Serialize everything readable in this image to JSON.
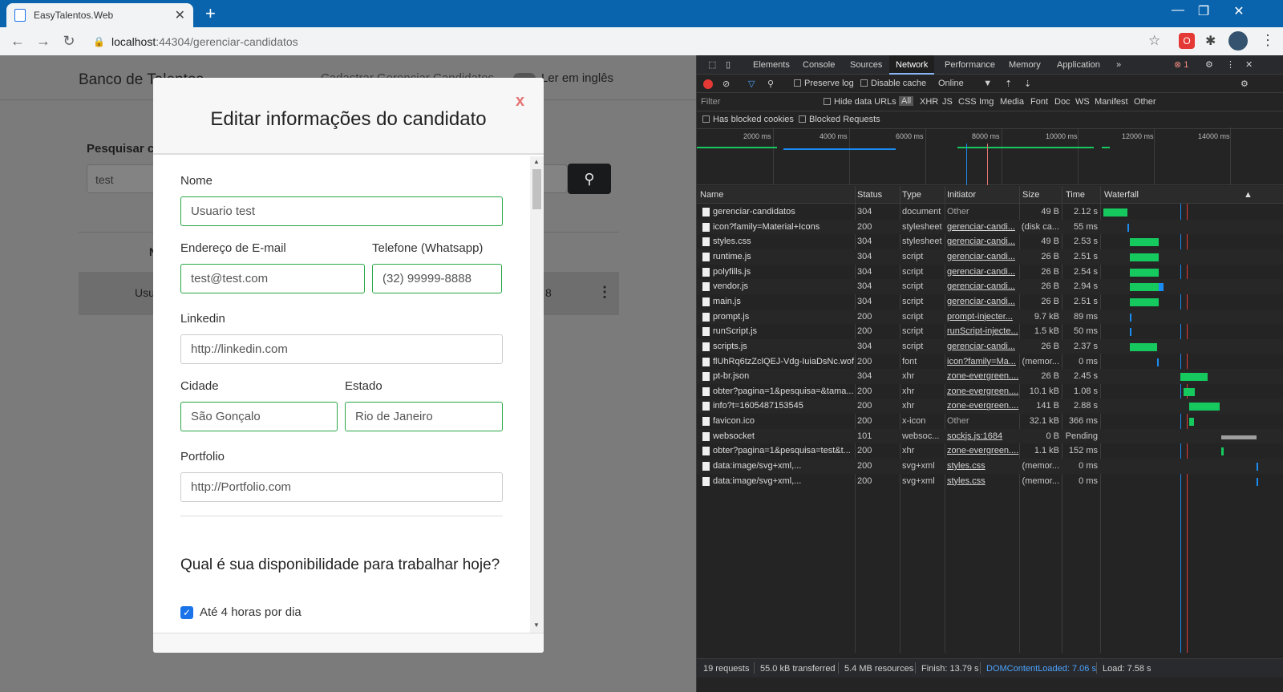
{
  "browser": {
    "tab_title": "EasyTalentos.Web",
    "url_host": "localhost",
    "url_path": ":44304/gerenciar-candidatos"
  },
  "page": {
    "brand": "Banco de Talentos",
    "nav_links": "Cadastrar   Gerenciar Candidatos",
    "lang_toggle": "Ler em inglês",
    "search_label": "Pesquisar c",
    "search_value": "test",
    "table_head": "N",
    "row_start": "Usu",
    "row_end": "8"
  },
  "modal": {
    "title": "Editar informações do candidato",
    "close": "x",
    "nome_label": "Nome",
    "nome_value": "Usuario test",
    "email_label": "Endereço de E-mail",
    "email_value": "test@test.com",
    "telefone_label": "Telefone (Whatsapp)",
    "telefone_value": "(32) 99999-8888",
    "linkedin_label": "Linkedin",
    "linkedin_placeholder": "http://linkedin.com",
    "cidade_label": "Cidade",
    "cidade_value": "São Gonçalo",
    "estado_label": "Estado",
    "estado_value": "Rio de Janeiro",
    "portfolio_label": "Portfolio",
    "portfolio_placeholder": "http://Portfolio.com",
    "question": "Qual é sua disponibilidade para trabalhar hoje?",
    "option1": "Até 4 horas por dia"
  },
  "devtools": {
    "tabs": [
      "Elements",
      "Console",
      "Sources",
      "Network",
      "Performance",
      "Memory",
      "Application"
    ],
    "error_count": "1",
    "preserve_log": "Preserve log",
    "disable_cache": "Disable cache",
    "throttle": "Online",
    "filter_placeholder": "Filter",
    "hide_data_urls": "Hide data URLs",
    "filter_types": [
      "All",
      "XHR",
      "JS",
      "CSS",
      "Img",
      "Media",
      "Font",
      "Doc",
      "WS",
      "Manifest",
      "Other"
    ],
    "has_blocked_cookies": "Has blocked cookies",
    "blocked_requests": "Blocked Requests",
    "ticks": [
      "2000 ms",
      "4000 ms",
      "6000 ms",
      "8000 ms",
      "10000 ms",
      "12000 ms",
      "14000 ms"
    ],
    "columns": [
      "Name",
      "Status",
      "Type",
      "Initiator",
      "Size",
      "Time",
      "Waterfall"
    ],
    "rows": [
      {
        "name": "gerenciar-candidatos",
        "status": "304",
        "type": "document",
        "initiator": "Other",
        "size": "49 B",
        "time": "2.12 s"
      },
      {
        "name": "icon?family=Material+Icons",
        "status": "200",
        "type": "stylesheet",
        "initiator": "gerenciar-candi...",
        "size": "(disk ca...",
        "time": "55 ms"
      },
      {
        "name": "styles.css",
        "status": "304",
        "type": "stylesheet",
        "initiator": "gerenciar-candi...",
        "size": "49 B",
        "time": "2.53 s"
      },
      {
        "name": "runtime.js",
        "status": "304",
        "type": "script",
        "initiator": "gerenciar-candi...",
        "size": "26 B",
        "time": "2.51 s"
      },
      {
        "name": "polyfills.js",
        "status": "304",
        "type": "script",
        "initiator": "gerenciar-candi...",
        "size": "26 B",
        "time": "2.54 s"
      },
      {
        "name": "vendor.js",
        "status": "304",
        "type": "script",
        "initiator": "gerenciar-candi...",
        "size": "26 B",
        "time": "2.94 s"
      },
      {
        "name": "main.js",
        "status": "304",
        "type": "script",
        "initiator": "gerenciar-candi...",
        "size": "26 B",
        "time": "2.51 s"
      },
      {
        "name": "prompt.js",
        "status": "200",
        "type": "script",
        "initiator": "prompt-injecter...",
        "size": "9.7 kB",
        "time": "89 ms"
      },
      {
        "name": "runScript.js",
        "status": "200",
        "type": "script",
        "initiator": "runScript-injecte...",
        "size": "1.5 kB",
        "time": "50 ms"
      },
      {
        "name": "scripts.js",
        "status": "304",
        "type": "script",
        "initiator": "gerenciar-candi...",
        "size": "26 B",
        "time": "2.37 s"
      },
      {
        "name": "flUhRq6tzZclQEJ-Vdg-IuiaDsNc.wof...",
        "status": "200",
        "type": "font",
        "initiator": "icon?family=Ma...",
        "size": "(memor...",
        "time": "0 ms"
      },
      {
        "name": "pt-br.json",
        "status": "304",
        "type": "xhr",
        "initiator": "zone-evergreen....",
        "size": "26 B",
        "time": "2.45 s"
      },
      {
        "name": "obter?pagina=1&pesquisa=&tama...",
        "status": "200",
        "type": "xhr",
        "initiator": "zone-evergreen....",
        "size": "10.1 kB",
        "time": "1.08 s"
      },
      {
        "name": "info?t=1605487153545",
        "status": "200",
        "type": "xhr",
        "initiator": "zone-evergreen....",
        "size": "141 B",
        "time": "2.88 s"
      },
      {
        "name": "favicon.ico",
        "status": "200",
        "type": "x-icon",
        "initiator": "Other",
        "size": "32.1 kB",
        "time": "366 ms"
      },
      {
        "name": "websocket",
        "status": "101",
        "type": "websoc...",
        "initiator": "sockjs.js:1684",
        "size": "0 B",
        "time": "Pending"
      },
      {
        "name": "obter?pagina=1&pesquisa=test&t...",
        "status": "200",
        "type": "xhr",
        "initiator": "zone-evergreen....",
        "size": "1.1 kB",
        "time": "152 ms"
      },
      {
        "name": "data:image/svg+xml,...",
        "status": "200",
        "type": "svg+xml",
        "initiator": "styles.css",
        "size": "(memor...",
        "time": "0 ms"
      },
      {
        "name": "data:image/svg+xml,...",
        "status": "200",
        "type": "svg+xml",
        "initiator": "styles.css",
        "size": "(memor...",
        "time": "0 ms"
      }
    ],
    "status": {
      "requests": "19 requests",
      "transferred": "55.0 kB transferred",
      "resources": "5.4 MB resources",
      "finish": "Finish: 13.79 s",
      "dcl": "DOMContentLoaded: 7.06 s",
      "load": "Load: 7.58 s"
    }
  }
}
